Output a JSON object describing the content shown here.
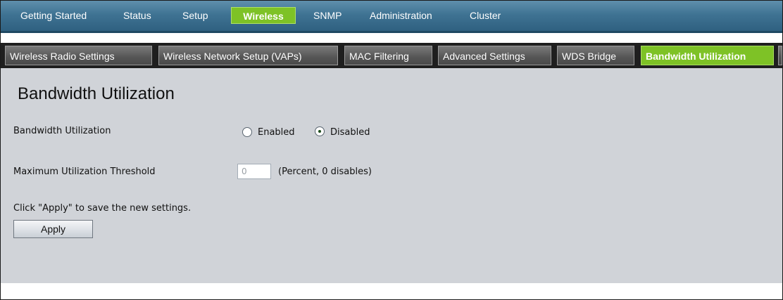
{
  "top_nav": {
    "items": [
      {
        "label": "Getting Started",
        "active": false
      },
      {
        "label": "Status",
        "active": false
      },
      {
        "label": "Setup",
        "active": false
      },
      {
        "label": "Wireless",
        "active": true
      },
      {
        "label": "SNMP",
        "active": false
      },
      {
        "label": "Administration",
        "active": false
      },
      {
        "label": "Cluster",
        "active": false
      }
    ]
  },
  "sub_nav": {
    "tabs": [
      {
        "label": "Wireless Radio Settings",
        "active": false
      },
      {
        "label": "Wireless Network Setup (VAPs)",
        "active": false
      },
      {
        "label": "MAC Filtering",
        "active": false
      },
      {
        "label": "Advanced Settings",
        "active": false
      },
      {
        "label": "WDS Bridge",
        "active": false
      },
      {
        "label": "Bandwidth Utilization",
        "active": true
      }
    ]
  },
  "page": {
    "title": "Bandwidth Utilization",
    "bandwidth": {
      "label": "Bandwidth Utilization",
      "option_enabled": "Enabled",
      "option_disabled": "Disabled",
      "selected": "Disabled"
    },
    "threshold": {
      "label": "Maximum Utilization Threshold",
      "value": "0",
      "hint": "(Percent, 0 disables)"
    },
    "apply_note": "Click \"Apply\" to save the new settings.",
    "apply_label": "Apply"
  },
  "colors": {
    "active_tab": "#7ec226",
    "top_nav_bg": "#3f7393",
    "sub_nav_bg": "#1f1f1f",
    "content_bg": "#d0d3d8"
  }
}
